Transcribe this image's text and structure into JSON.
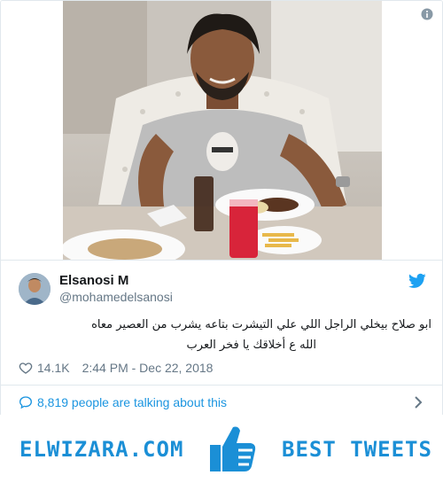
{
  "tweet": {
    "author": {
      "name": "Elsanosi M",
      "handle": "@mohamedelsanosi"
    },
    "text_line1": "ابو صلاح بيخلي الراجل اللي علي التيشرت بتاعه يشرب من العصير معاه",
    "text_line2": "الله ع أخلاقك يا فخر العرب",
    "likes": "14.1K",
    "timestamp": "2:44 PM - Dec 22, 2018",
    "talking": "8,819 people are talking about this"
  },
  "banner": {
    "left_text": "ELWIZARA.COM",
    "right_text": "BEST TWEETS"
  },
  "colors": {
    "accent": "#1b95e0",
    "brand": "#1b8fd6",
    "secondary_text": "#657786"
  },
  "icons": [
    "info-icon",
    "twitter-bird-icon",
    "heart-icon",
    "comment-bubble-icon",
    "chevron-right-icon",
    "thumbs-up-icon"
  ]
}
